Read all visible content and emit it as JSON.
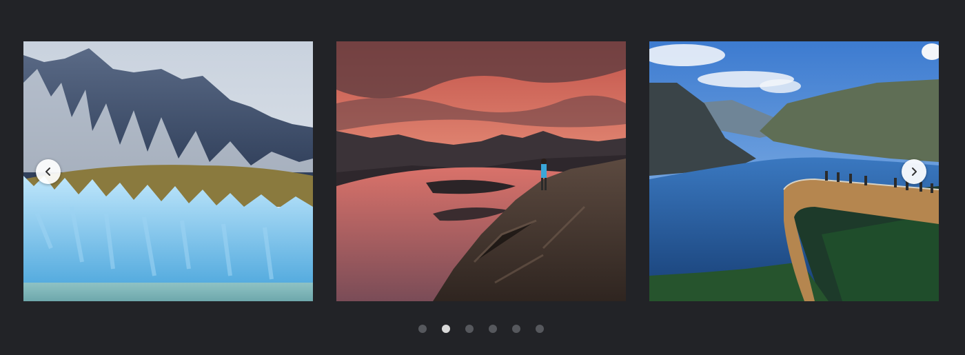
{
  "carousel": {
    "slides": [
      {
        "icon": "glacier-mountain-photo"
      },
      {
        "icon": "sunset-lake-cliff-photo"
      },
      {
        "icon": "fjord-viewpoint-photo"
      }
    ],
    "prev_icon": "chevron-left-icon",
    "next_icon": "chevron-right-icon",
    "dot_count": 6,
    "active_dot": 2
  },
  "colors": {
    "background": "#222327",
    "dot_inactive": "#56585d",
    "dot_active": "#d9d9d9"
  }
}
